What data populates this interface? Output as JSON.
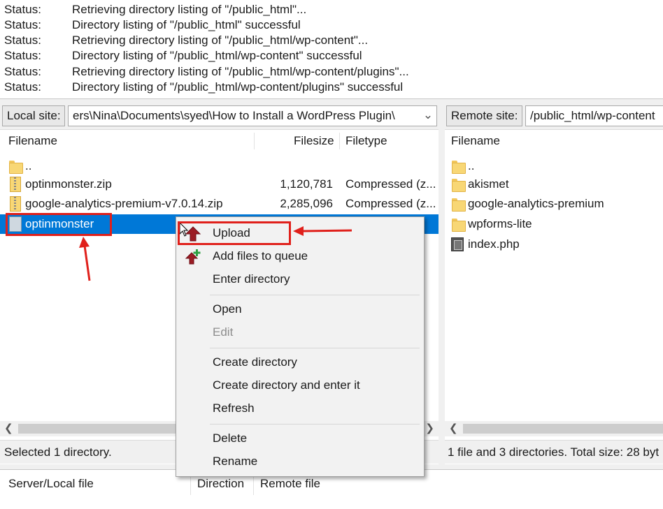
{
  "log": [
    {
      "key": "Status:",
      "msg": "Retrieving directory listing of \"/public_html\"..."
    },
    {
      "key": "Status:",
      "msg": "Directory listing of \"/public_html\" successful"
    },
    {
      "key": "Status:",
      "msg": "Retrieving directory listing of \"/public_html/wp-content\"..."
    },
    {
      "key": "Status:",
      "msg": "Directory listing of \"/public_html/wp-content\" successful"
    },
    {
      "key": "Status:",
      "msg": "Retrieving directory listing of \"/public_html/wp-content/plugins\"..."
    },
    {
      "key": "Status:",
      "msg": "Directory listing of \"/public_html/wp-content/plugins\" successful"
    }
  ],
  "local": {
    "label": "Local site:",
    "path": "ers\\Nina\\Documents\\syed\\How to Install a WordPress Plugin\\",
    "columns": {
      "name": "Filename",
      "size": "Filesize",
      "type": "Filetype"
    },
    "rows": [
      {
        "name": "..",
        "size": "",
        "type": ""
      },
      {
        "name": "optinmonster.zip",
        "size": "1,120,781",
        "type": "Compressed (z..."
      },
      {
        "name": "google-analytics-premium-v7.0.14.zip",
        "size": "2,285,096",
        "type": "Compressed (z..."
      },
      {
        "name": "optinmonster",
        "size": "",
        "type": ""
      }
    ],
    "status": "Selected 1 directory."
  },
  "remote": {
    "label": "Remote site:",
    "path": "/public_html/wp-content",
    "columns": {
      "name": "Filename"
    },
    "rows": [
      {
        "name": ".."
      },
      {
        "name": "akismet"
      },
      {
        "name": "google-analytics-premium"
      },
      {
        "name": "wpforms-lite"
      },
      {
        "name": "index.php"
      }
    ],
    "status": "1 file and 3 directories. Total size: 28 byt"
  },
  "queue": {
    "col1": "Server/Local file",
    "col2": "Direction",
    "col3": "Remote file"
  },
  "menu": {
    "upload": "Upload",
    "add_to_queue": "Add files to queue",
    "enter_directory": "Enter directory",
    "open": "Open",
    "edit": "Edit",
    "create_directory": "Create directory",
    "create_and_enter": "Create directory and enter it",
    "refresh": "Refresh",
    "delete": "Delete",
    "rename": "Rename"
  },
  "colors": {
    "selection": "#0078d7",
    "annotation": "#e0201b",
    "upload_arrow": "#9b1c24",
    "queue_plus": "#2ea043"
  }
}
